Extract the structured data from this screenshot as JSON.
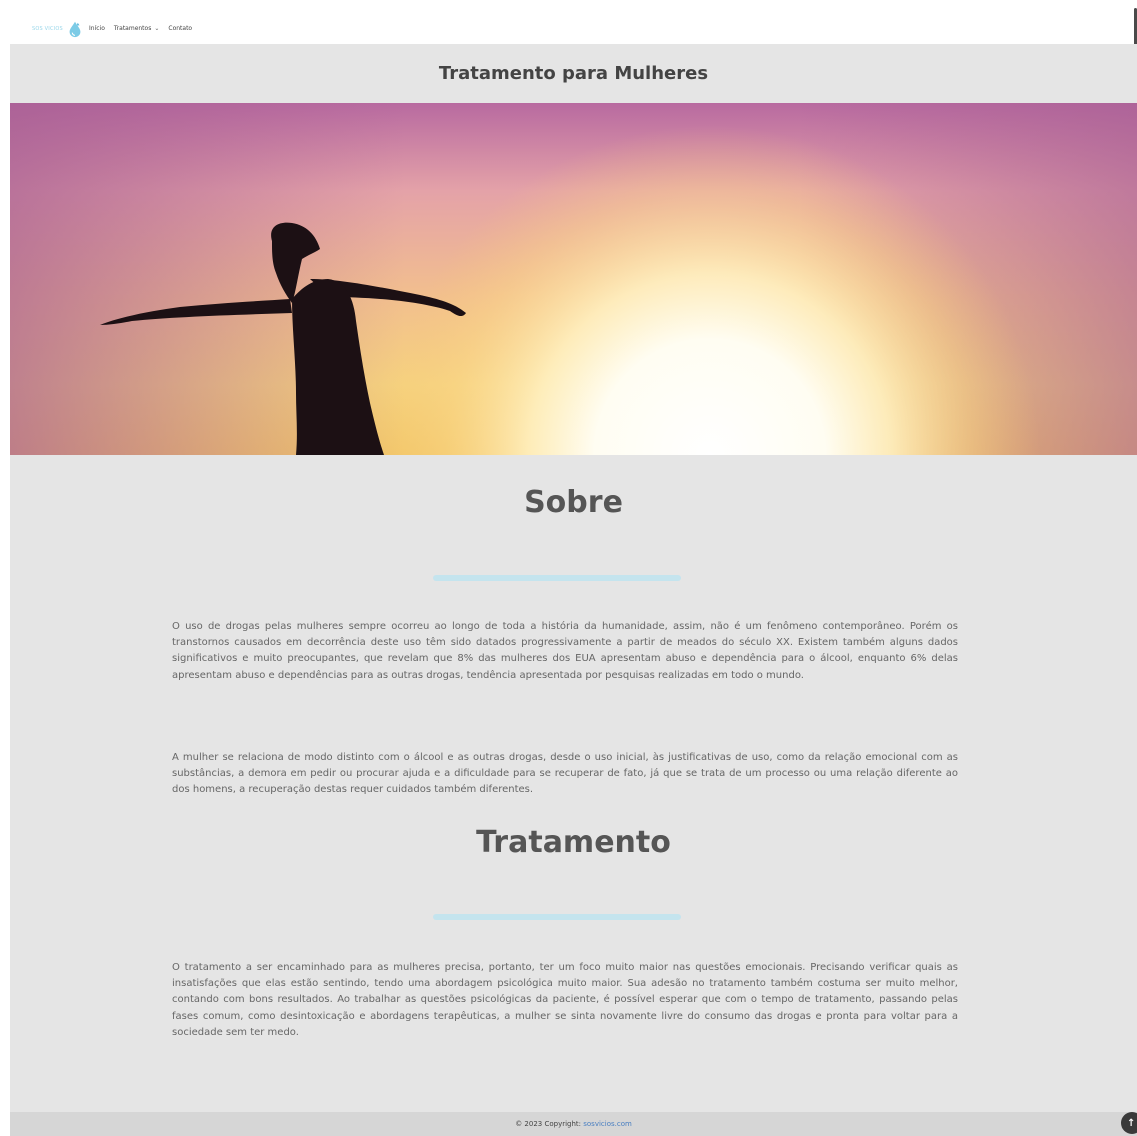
{
  "nav": {
    "logo_text": "SOS VICIOS",
    "items": [
      {
        "label": "Início"
      },
      {
        "label": "Tratamentos",
        "has_dropdown": true
      },
      {
        "label": "Contato"
      }
    ]
  },
  "page": {
    "title": "Tratamento para Mulheres"
  },
  "sections": [
    {
      "heading": "Sobre",
      "paragraphs": [
        "O uso de drogas pelas mulheres sempre ocorreu ao longo de toda a história da humanidade, assim, não é um fenômeno contemporâneo. Porém os transtornos causados em decorrência deste uso têm sido datados progressivamente a partir de meados do século XX. Existem também alguns dados significativos e muito preocupantes, que revelam que 8% das mulheres dos EUA apresentam abuso e dependência para o álcool, enquanto 6% delas apresentam abuso e dependências para as outras drogas, tendência apresentada por pesquisas realizadas em todo o mundo.",
        "A mulher se relaciona de modo distinto com o álcool e as outras drogas, desde o uso inicial, às justificativas de uso, como da relação emocional com as substâncias, a demora em pedir ou procurar ajuda e a dificuldade para se recuperar de fato, já que se trata de um processo ou uma relação diferente ao dos homens, a recuperação destas requer cuidados também diferentes."
      ]
    },
    {
      "heading": "Tratamento",
      "paragraphs": [
        "O tratamento a ser encaminhado para as mulheres precisa, portanto, ter um foco muito maior nas questões emocionais. Precisando verificar quais as insatisfações que elas estão sentindo, tendo uma abordagem psicológica muito maior. Sua adesão no tratamento também costuma ser muito melhor, contando com bons resultados. Ao trabalhar as questões psicológicas da paciente, é possível esperar que com o tempo de tratamento, passando pelas fases comum, como desintoxicação e abordagens terapêuticas, a mulher se sinta novamente livre do consumo das drogas e pronta para voltar para a sociedade sem ter medo."
      ]
    }
  ],
  "footer": {
    "copyright": "© 2023 Copyright:",
    "link_text": "sosvicios.com"
  },
  "icons": {
    "logo": "drop-logo-icon",
    "dropdown": "chevron-down-icon",
    "back_to_top": "arrow-up-icon"
  },
  "colors": {
    "accent": "#c4e4ee",
    "link": "#4a7fc1",
    "content_bg": "#e5e5e5"
  }
}
